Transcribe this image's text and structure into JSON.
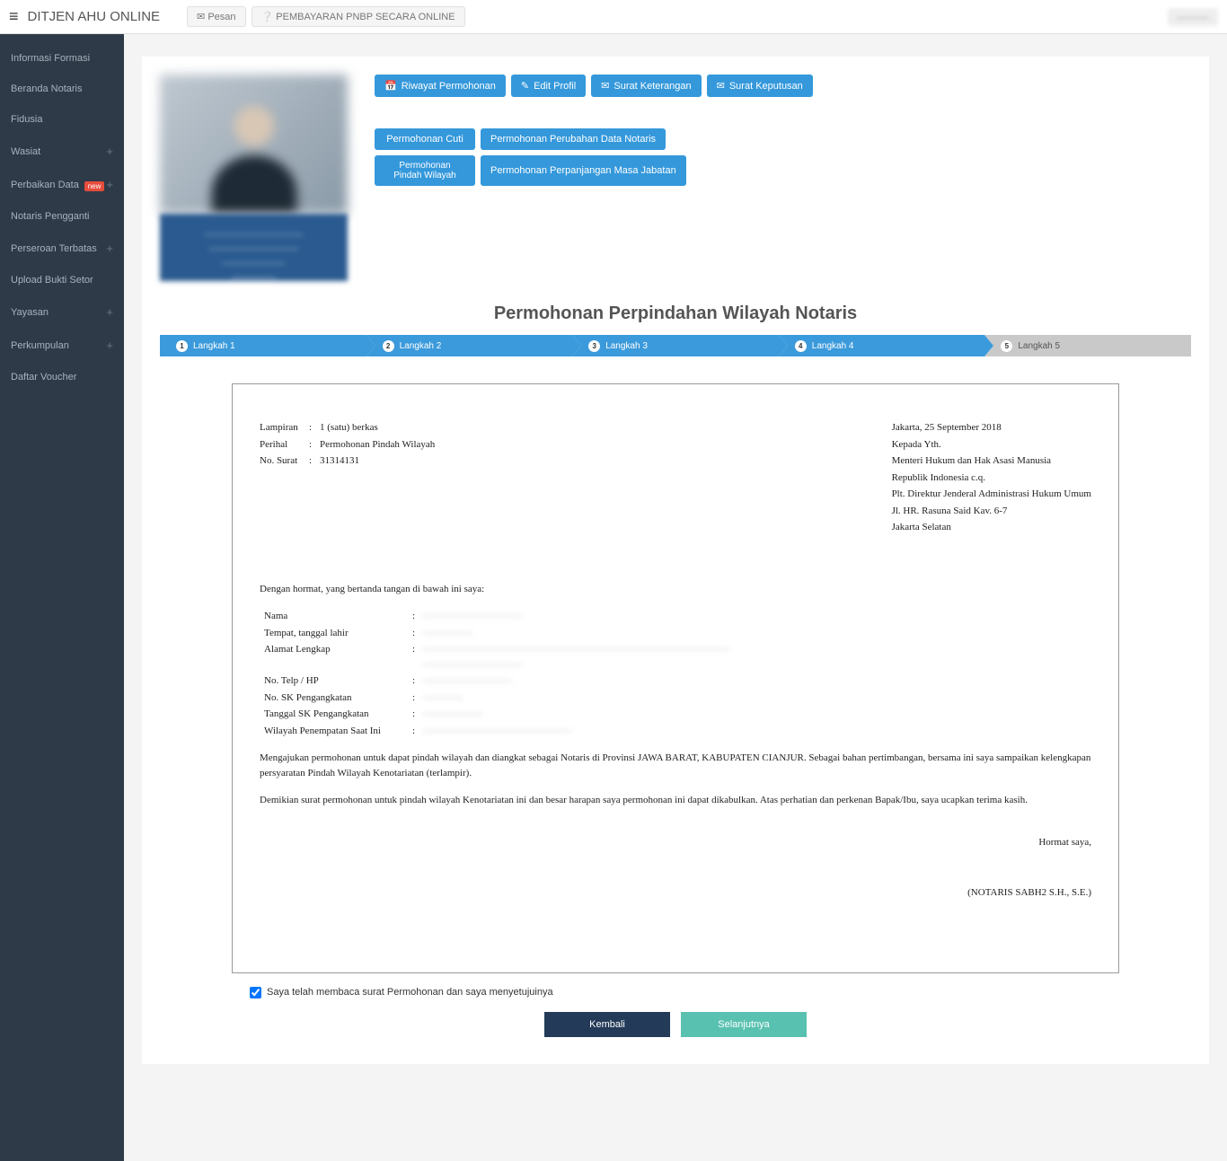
{
  "topbar": {
    "brand": "DITJEN AHU ONLINE",
    "pesan": "Pesan",
    "pnbp": "PEMBAYARAN PNBP SECARA ONLINE",
    "user": "———"
  },
  "sidebar": {
    "items": [
      {
        "label": "Informasi Formasi",
        "plus": false
      },
      {
        "label": "Beranda Notaris",
        "plus": false
      },
      {
        "label": "Fidusia",
        "plus": false
      },
      {
        "label": "Wasiat",
        "plus": true
      },
      {
        "label": "Perbaikan Data",
        "plus": true,
        "new": true
      },
      {
        "label": "Notaris Pengganti",
        "plus": false
      },
      {
        "label": "Perseroan Terbatas",
        "plus": true
      },
      {
        "label": "Upload Bukti Setor",
        "plus": false
      },
      {
        "label": "Yayasan",
        "plus": true
      },
      {
        "label": "Perkumpulan",
        "plus": true
      },
      {
        "label": "Daftar Voucher",
        "plus": false
      }
    ],
    "new_label": "new"
  },
  "actions1": {
    "riwayat": "Riwayat Permohonan",
    "edit": "Edit Profil",
    "keterangan": "Surat Keterangan",
    "keputusan": "Surat Keputusan"
  },
  "actions2": {
    "cuti": "Permohonan Cuti",
    "perubahan": "Permohonan Perubahan Data Notaris",
    "pindah": "Permohonan Pindah Wilayah",
    "perpanjangan": "Permohonan Perpanjangan Masa Jabatan"
  },
  "profile": {
    "caption1": "———————————",
    "caption2": "——————————",
    "caption3": "———————",
    "caption4": "—————"
  },
  "page_title": "Permohonan Perpindahan Wilayah Notaris",
  "steps": [
    "Langkah 1",
    "Langkah 2",
    "Langkah 3",
    "Langkah 4",
    "Langkah 5"
  ],
  "doc": {
    "labels": {
      "lampiran": "Lampiran",
      "perihal": "Perihal",
      "nosurat": "No. Surat"
    },
    "lampiran_val": "1 (satu) berkas",
    "perihal_val": "Permohonan Pindah Wilayah",
    "nosurat_val": "31314131",
    "right": {
      "place_date": "Jakarta, 25 September 2018",
      "kepada": "Kepada Yth.",
      "menteri": "Menteri Hukum dan Hak Asasi Manusia",
      "ri": "Republik Indonesia c.q.",
      "plt": "Plt. Direktur Jenderal Administrasi Hukum Umum",
      "alamat": "Jl. HR. Rasuna Said Kav. 6-7",
      "kota": "Jakarta Selatan"
    },
    "opening": "Dengan hormat, yang bertanda tangan di bawah ini saya:",
    "fields": {
      "nama": "Nama",
      "ttl": "Tempat, tanggal lahir",
      "alamat": "Alamat Lengkap",
      "telp": "No. Telp / HP",
      "sk": "No. SK Pengangkatan",
      "tgl_sk": "Tanggal SK Pengangkatan",
      "wilayah": "Wilayah Penempatan Saat Ini"
    },
    "vals": {
      "nama": "——————————",
      "ttl": "—————",
      "alamat": "———————————————————————————————",
      "alamat2": "——————————",
      "telp": "—————————",
      "sk": "————",
      "tgl_sk": "——————",
      "wilayah": "———————————————"
    },
    "para1": "Mengajukan permohonan untuk dapat pindah wilayah dan diangkat sebagai Notaris di Provinsi JAWA BARAT, KABUPATEN CIANJUR. Sebagai bahan pertimbangan, bersama ini saya sampaikan kelengkapan persyaratan Pindah Wilayah Kenotariatan (terlampir).",
    "para2": "Demikian surat permohonan untuk pindah wilayah Kenotariatan ini dan besar harapan saya permohonan ini dapat dikabulkan. Atas perhatian dan perkenan Bapak/Ibu, saya ucapkan terima kasih.",
    "hormat": "Hormat saya,",
    "signer": "(NOTARIS SABH2 S.H., S.E.)"
  },
  "confirm": "Saya telah membaca surat Permohonan dan saya menyetujuinya",
  "buttons": {
    "kembali": "Kembali",
    "selanjutnya": "Selanjutnya"
  }
}
